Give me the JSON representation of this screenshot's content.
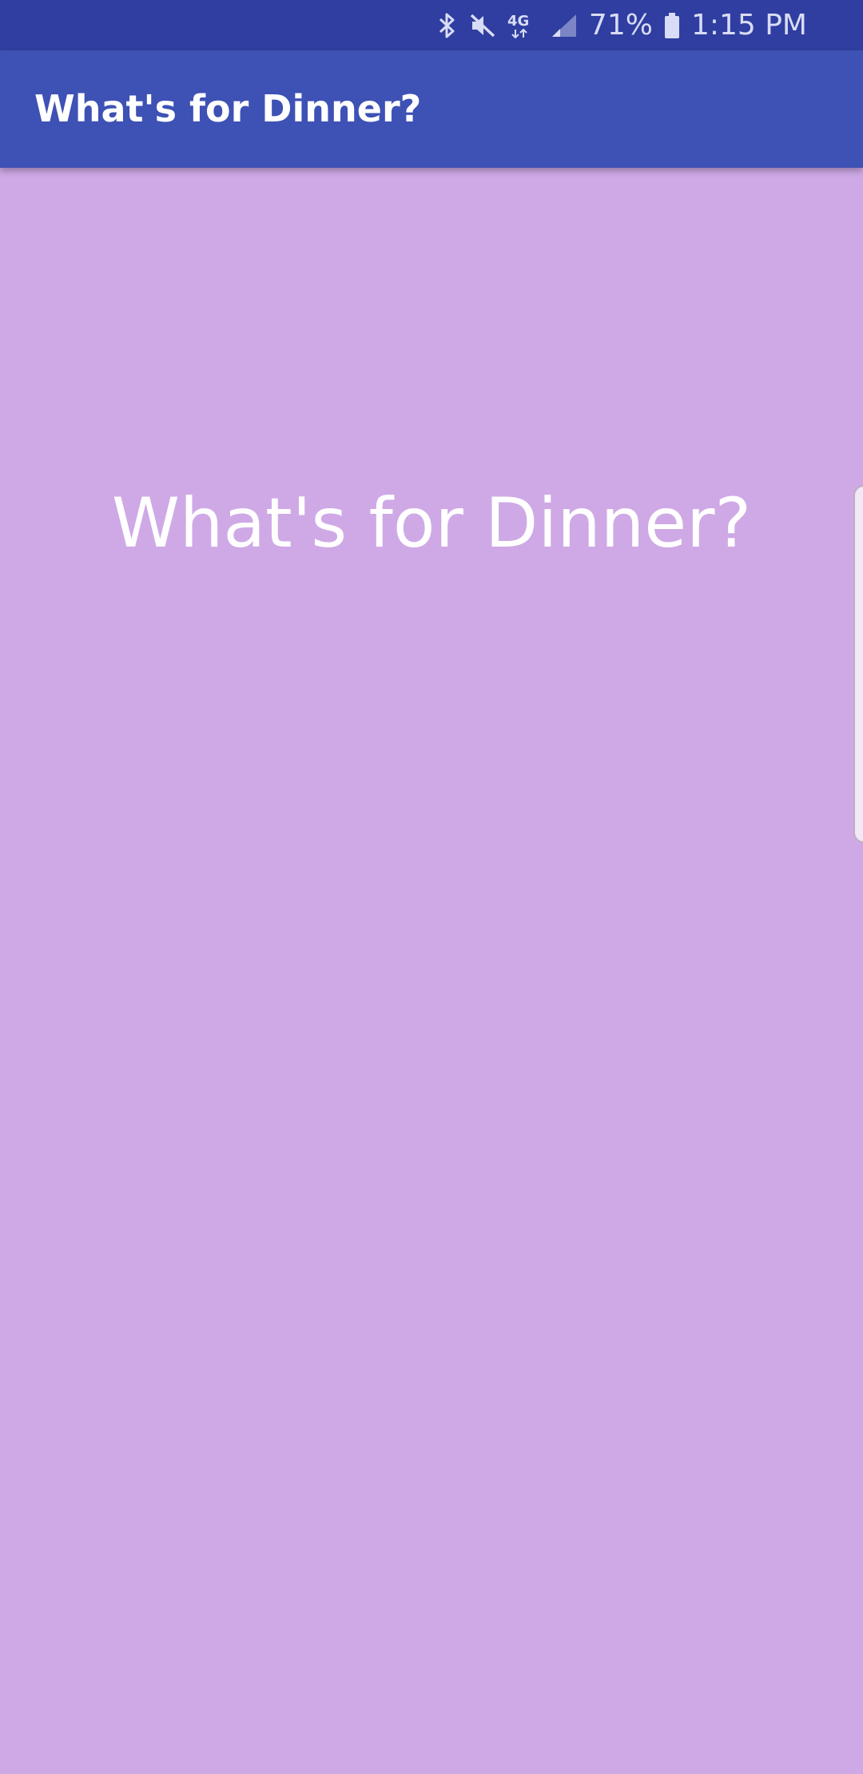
{
  "status_bar": {
    "battery_percent": "71%",
    "time": "1:15 PM",
    "network": "4G",
    "icons": [
      "bluetooth-icon",
      "mute-icon",
      "network-4g-icon",
      "signal-icon",
      "battery-icon"
    ],
    "background": "#2f3ea0"
  },
  "app_bar": {
    "title": "What's for Dinner?",
    "background": "#3e51b5"
  },
  "main": {
    "heading": "What's for Dinner?",
    "background": "#cfa9e6"
  }
}
